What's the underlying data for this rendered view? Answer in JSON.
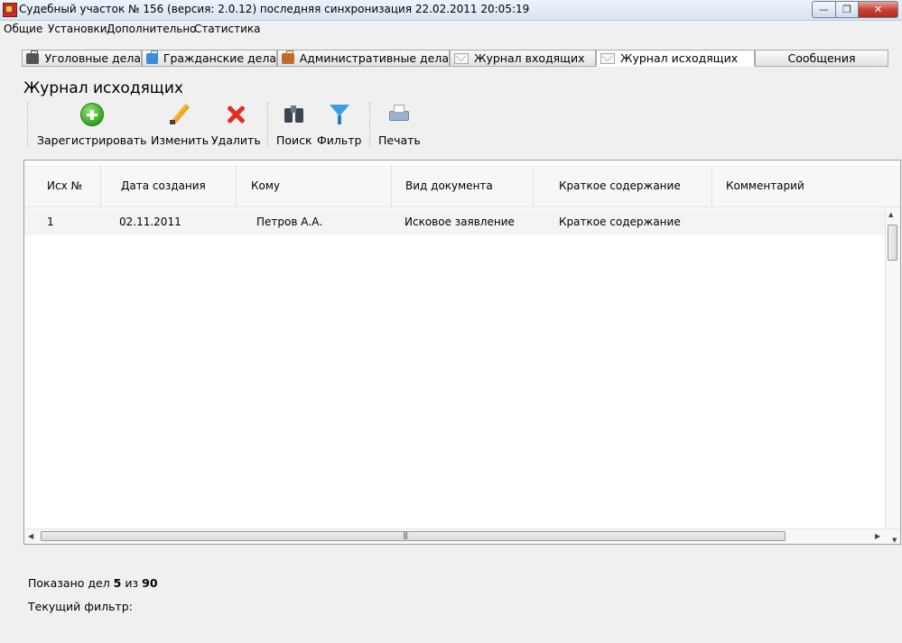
{
  "window": {
    "title": "Судебный участок № 156 (версия: 2.0.12) последняя синхронизация 22.02.2011 20:05:19",
    "min_glyph": "—",
    "max_glyph": "❐",
    "close_glyph": "✕"
  },
  "menu": {
    "items": [
      "Общие",
      "Установки",
      "Дополнительно",
      "Статистика"
    ]
  },
  "tabs": [
    {
      "label": "Уголовные дела",
      "icon": "criminal-case-briefcase-icon"
    },
    {
      "label": "Гражданские дела",
      "icon": "civil-case-briefcase-icon"
    },
    {
      "label": "Административные дела",
      "icon": "admin-case-briefcase-icon"
    },
    {
      "label": "Журнал входящих",
      "icon": "envelope-icon"
    },
    {
      "label": "Журнал исходящих",
      "icon": "envelope-icon",
      "active": true
    },
    {
      "label": "Сообщения"
    }
  ],
  "page": {
    "title": "Журнал исходящих"
  },
  "toolbar": {
    "register": "Зарегистрировать",
    "edit": "Изменить",
    "delete": "Удалить",
    "search": "Поиск",
    "filter": "Фильтр",
    "print": "Печать"
  },
  "table": {
    "columns": [
      "Исх №",
      "Дата создания",
      "Кому",
      "Вид документа",
      "Краткое содержание",
      "Комментарий"
    ],
    "rows": [
      [
        "1",
        "02.11.2011",
        "Петров А.А.",
        "Исковое заявление",
        "Краткое содержание",
        ""
      ]
    ]
  },
  "footer": {
    "shown_prefix": "Показано дел",
    "shown_count": "5",
    "shown_of": "из",
    "shown_total": "90",
    "filter_label": "Текущий фильтр:"
  }
}
